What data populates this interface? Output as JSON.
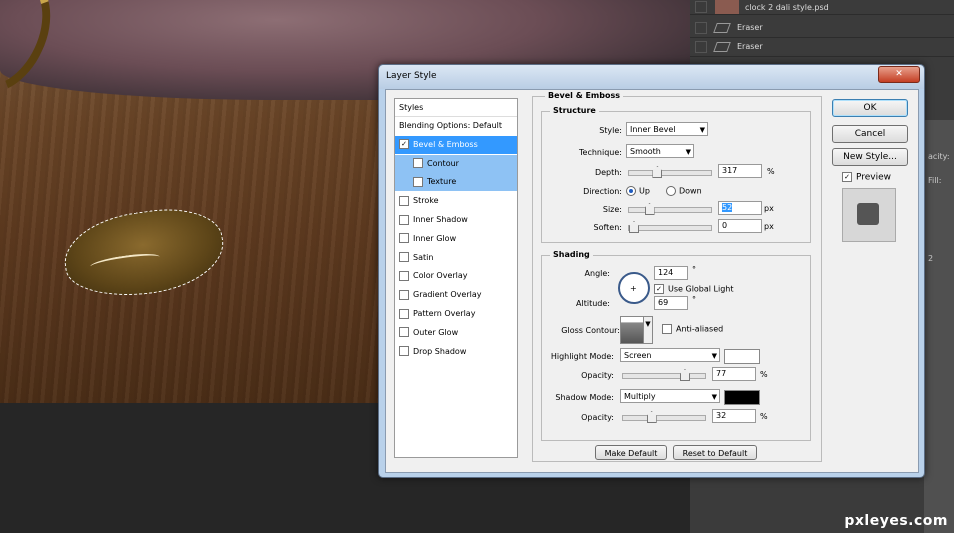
{
  "layers": {
    "file_name": "clock 2 dali style.psd",
    "items": [
      "Eraser",
      "Eraser"
    ],
    "side_labels": [
      "acity:",
      "Fill:",
      "2"
    ]
  },
  "watermark": "pxleyes.com",
  "dialog": {
    "title": "Layer Style",
    "close_glyph": "✕",
    "styles_header": "Styles",
    "styles": [
      {
        "label": "Blending Options: Default",
        "checkbox": false,
        "checked": false
      },
      {
        "label": "Bevel & Emboss",
        "checkbox": true,
        "checked": true,
        "selected": true
      },
      {
        "label": "Contour",
        "checkbox": true,
        "checked": false,
        "sub": true
      },
      {
        "label": "Texture",
        "checkbox": true,
        "checked": false,
        "sub": true
      },
      {
        "label": "Stroke",
        "checkbox": true,
        "checked": false
      },
      {
        "label": "Inner Shadow",
        "checkbox": true,
        "checked": false
      },
      {
        "label": "Inner Glow",
        "checkbox": true,
        "checked": false
      },
      {
        "label": "Satin",
        "checkbox": true,
        "checked": false
      },
      {
        "label": "Color Overlay",
        "checkbox": true,
        "checked": false
      },
      {
        "label": "Gradient Overlay",
        "checkbox": true,
        "checked": false
      },
      {
        "label": "Pattern Overlay",
        "checkbox": true,
        "checked": false
      },
      {
        "label": "Outer Glow",
        "checkbox": true,
        "checked": false
      },
      {
        "label": "Drop Shadow",
        "checkbox": true,
        "checked": false
      }
    ],
    "section_title": "Bevel & Emboss",
    "structure": {
      "title": "Structure",
      "style_label": "Style:",
      "style_value": "Inner Bevel",
      "technique_label": "Technique:",
      "technique_value": "Smooth",
      "depth_label": "Depth:",
      "depth_value": "317",
      "depth_unit": "%",
      "depth_level": 0.317,
      "direction_label": "Direction:",
      "direction_up": "Up",
      "direction_down": "Down",
      "direction_selected": "Up",
      "size_label": "Size:",
      "size_value": "52",
      "size_unit": "px",
      "size_level": 0.21,
      "soften_label": "Soften:",
      "soften_value": "0",
      "soften_unit": "px",
      "soften_level": 0
    },
    "shading": {
      "title": "Shading",
      "angle_label": "Angle:",
      "angle_value": "124",
      "angle_unit": "°",
      "global_light_label": "Use Global Light",
      "global_light_checked": true,
      "altitude_label": "Altitude:",
      "altitude_value": "69",
      "altitude_unit": "°",
      "gloss_label": "Gloss Contour:",
      "antialiased_label": "Anti-aliased",
      "antialiased_checked": false,
      "highlight_mode_label": "Highlight Mode:",
      "highlight_mode_value": "Screen",
      "highlight_color": "#ffffff",
      "highlight_opacity_label": "Opacity:",
      "highlight_opacity_value": "77",
      "highlight_opacity_unit": "%",
      "highlight_opacity_level": 0.77,
      "shadow_mode_label": "Shadow Mode:",
      "shadow_mode_value": "Multiply",
      "shadow_color": "#000000",
      "shadow_opacity_label": "Opacity:",
      "shadow_opacity_value": "32",
      "shadow_opacity_unit": "%",
      "shadow_opacity_level": 0.32
    },
    "make_default": "Make Default",
    "reset_default": "Reset to Default",
    "ok": "OK",
    "cancel": "Cancel",
    "new_style": "New Style...",
    "preview_label": "Preview",
    "preview_checked": true
  },
  "colors": {
    "accent_selected": "#3399ff",
    "sub_selected": "#8ec2f4"
  }
}
